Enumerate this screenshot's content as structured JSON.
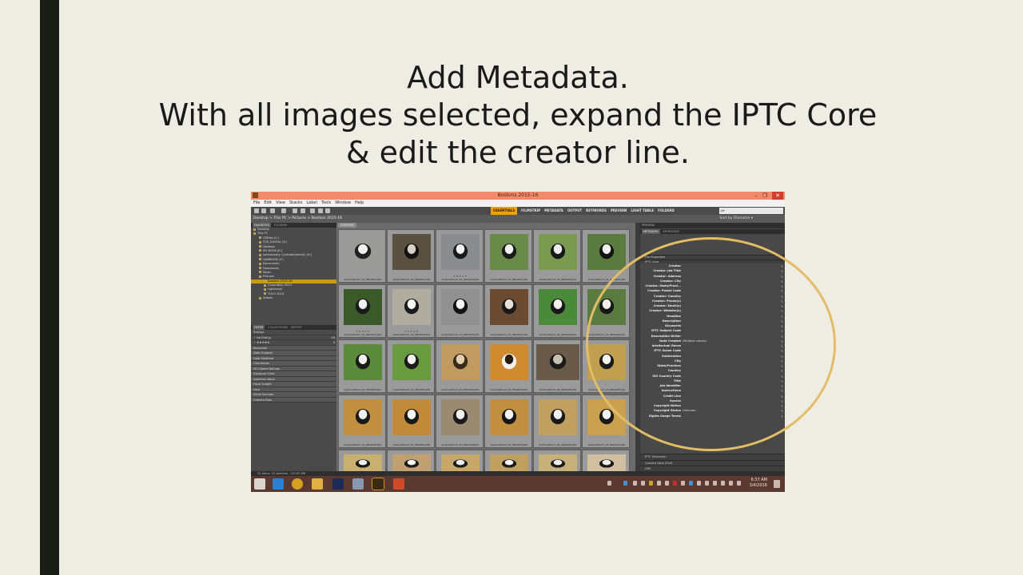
{
  "slide": {
    "title_lines": [
      "Add Metadata.",
      "With all images selected, expand the IPTC Core",
      "& edit the creator line."
    ],
    "colors": {
      "background": "#efece4",
      "left_bar": "#1a1c16",
      "annotation_circle": "#e3bd66"
    }
  },
  "window": {
    "title": "Bostons 2015-16",
    "controls": [
      "–",
      "❐",
      "✕"
    ]
  },
  "menu": [
    "File",
    "Edit",
    "View",
    "Stacks",
    "Label",
    "Tools",
    "Window",
    "Help"
  ],
  "workspaces": [
    "ESSENTIALS",
    "FILMSTRIP",
    "METADATA",
    "OUTPUT",
    "KEYWORDS",
    "PREVIEW",
    "LIGHT TABLE",
    "FOLDERS"
  ],
  "search_placeholder": "ρ▾",
  "breadcrumb": "Desktop  >  This PC  >  Pictures  >  Bostons 2015-16",
  "sort_label": "Sort by Filename ▾",
  "left_panel": {
    "tabs": [
      "FAVORITES",
      "FOLDERS"
    ],
    "favorites": [
      "Desktop",
      "This PC",
      "CRDisk (C:)",
      "FOX_DIGITAL (E:)",
      "Desktop",
      "MY BOOK (E:)",
      "sanbarlowry (\\\\vitoda\\home$) (H:)",
      "HUMBOOK (Y:)",
      "Documents",
      "Downloads",
      "Music",
      "Pictures",
      "Bostons 2015-16",
      "Coronation 2014",
      "Lightroom",
      "TOLO 2016",
      "Videos"
    ],
    "selected_favorite_index": 12,
    "filter_tabs": [
      "FILTER",
      "COLLECTIONS",
      "EXPORT"
    ],
    "filters": [
      {
        "label": "Ratings",
        "count": ""
      },
      {
        "label": "✓ No Rating",
        "count": "28"
      },
      {
        "label": "✓ ★★★★★",
        "count": "4"
      },
      {
        "label": "Keywords",
        "count": ""
      },
      {
        "label": "Date Created",
        "count": ""
      },
      {
        "label": "Date Modified",
        "count": ""
      },
      {
        "label": "Orientation",
        "count": ""
      },
      {
        "label": "ISO Speed Ratings",
        "count": ""
      },
      {
        "label": "Exposure Time",
        "count": ""
      },
      {
        "label": "Aperture Value",
        "count": ""
      },
      {
        "label": "Focal Length",
        "count": ""
      },
      {
        "label": "Lens",
        "count": ""
      },
      {
        "label": "Serial Number",
        "count": ""
      },
      {
        "label": "Camera Raw",
        "count": ""
      }
    ]
  },
  "content": {
    "tab": "CONTENT",
    "thumbnails": [
      {
        "label": "bostonsPhar5_16_IMG0010.JPG",
        "stars": ""
      },
      {
        "label": "bostonsPhar5_16_IMG0011.JPG",
        "stars": ""
      },
      {
        "label": "bostonsPhar5_16_IMG0016.JPG",
        "stars": "★★★★★"
      },
      {
        "label": "bostonsPhar5_16_IMG0021.JPG",
        "stars": ""
      },
      {
        "label": "bostonsPhar5_16_IMG0022.JPG",
        "stars": ""
      },
      {
        "label": "bostonsPhar5_16_IMG0023.JPG",
        "stars": ""
      },
      {
        "label": "bostonsPhar5_16_IMG0024.JPG",
        "stars": "★★★★★"
      },
      {
        "label": "bostonsPhar5_16_IMG0025.JPG",
        "stars": "★★★★★"
      },
      {
        "label": "bostonsPhar5_16_IMG0026.JPG",
        "stars": ""
      },
      {
        "label": "bostonsPhar5_16_IMG0027.JPG",
        "stars": ""
      },
      {
        "label": "bostonsPhar5_16_IMG0028.JPG",
        "stars": ""
      },
      {
        "label": "bostonsPhar5_16_IMG0029.JPG",
        "stars": ""
      },
      {
        "label": "bostonsPhar5_16_IMG0030.JPG",
        "stars": ""
      },
      {
        "label": "bostonsPhar5_16_IMG0031.JPG",
        "stars": ""
      },
      {
        "label": "bostonsPhar5_16_IMG0032.JPG",
        "stars": ""
      },
      {
        "label": "bostonsPhar5_16_IMG0033.JPG",
        "stars": ""
      },
      {
        "label": "bostonsPhar5_16_IMG0034.JPG",
        "stars": ""
      },
      {
        "label": "bostonsPhar5_16_IMG0035.JPG",
        "stars": ""
      },
      {
        "label": "bostonsPhar5_16_IMG0036.JPG",
        "stars": ""
      },
      {
        "label": "bostonsPhar5_16_IMG0037.JPG",
        "stars": ""
      },
      {
        "label": "bostonsPhar5_16_IMG0038.JPG",
        "stars": ""
      },
      {
        "label": "bostonsPhar5_16_IMG0039.JPG",
        "stars": ""
      },
      {
        "label": "bostonsPhar5_16_IMG0040.JPG",
        "stars": ""
      },
      {
        "label": "bostonsPhar5_16_IMG0041.JPG",
        "stars": ""
      },
      {
        "label": "",
        "stars": ""
      },
      {
        "label": "",
        "stars": ""
      },
      {
        "label": "",
        "stars": ""
      },
      {
        "label": "",
        "stars": ""
      },
      {
        "label": "",
        "stars": ""
      },
      {
        "label": "",
        "stars": ""
      }
    ]
  },
  "right_panel": {
    "preview_tab": "PREVIEW",
    "tabs": [
      "METADATA",
      "KEYWORDS"
    ],
    "sections": [
      "File Properties",
      "IPTC Core"
    ],
    "iptc_fields": [
      {
        "label": "Creator",
        "value": ""
      },
      {
        "label": "Creator: Job Title",
        "value": ""
      },
      {
        "label": "Creator: Address",
        "value": ""
      },
      {
        "label": "Creator: City",
        "value": ""
      },
      {
        "label": "Creator: State/Provi...",
        "value": ""
      },
      {
        "label": "Creator: Postal Code",
        "value": ""
      },
      {
        "label": "Creator: Country",
        "value": ""
      },
      {
        "label": "Creator: Phone(s)",
        "value": ""
      },
      {
        "label": "Creator: Email(s)",
        "value": ""
      },
      {
        "label": "Creator: Website(s)",
        "value": ""
      },
      {
        "label": "Headline",
        "value": ""
      },
      {
        "label": "Description",
        "value": ""
      },
      {
        "label": "Keywords",
        "value": ""
      },
      {
        "label": "IPTC Subject Code",
        "value": ""
      },
      {
        "label": "Description Writer",
        "value": ""
      },
      {
        "label": "Date Created",
        "value": "(Multiple values)"
      },
      {
        "label": "Intellectual Genre",
        "value": ""
      },
      {
        "label": "IPTC Scene Code",
        "value": ""
      },
      {
        "label": "Sublocation",
        "value": ""
      },
      {
        "label": "City",
        "value": ""
      },
      {
        "label": "State/Province",
        "value": ""
      },
      {
        "label": "Country",
        "value": ""
      },
      {
        "label": "ISO Country Code",
        "value": ""
      },
      {
        "label": "Title",
        "value": ""
      },
      {
        "label": "Job Identifier",
        "value": ""
      },
      {
        "label": "Instructions",
        "value": ""
      },
      {
        "label": "Credit Line",
        "value": ""
      },
      {
        "label": "Source",
        "value": ""
      },
      {
        "label": "Copyright Notice",
        "value": ""
      },
      {
        "label": "Copyright Status",
        "value": "Unknown"
      },
      {
        "label": "Rights Usage Terms",
        "value": ""
      }
    ],
    "subsections": [
      "IPTC Extension",
      "Camera Data (Exif)",
      "GPS",
      "Video",
      "DICOM",
      "Mobile SWF"
    ]
  },
  "statusbar": "32 items, 32 selected - 197.62 MB",
  "taskbar": {
    "apps": [
      "windows-start",
      "internet-explorer",
      "chrome",
      "file-explorer",
      "photoshop",
      "network-app",
      "bridge",
      "powerpoint"
    ],
    "time": "6:37 AM",
    "date": "3/4/2016"
  }
}
